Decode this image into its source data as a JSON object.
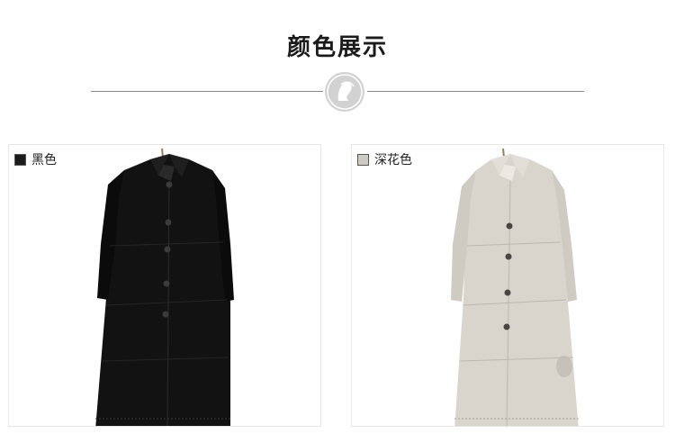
{
  "section": {
    "title": "颜色展示"
  },
  "colors": [
    {
      "label": "黑色",
      "swatch_color": "#1c1c1c",
      "icon": "black-swatch-icon"
    },
    {
      "label": "深花色",
      "swatch_color": "#cfcbc3",
      "icon": "oatmeal-swatch-icon"
    }
  ],
  "theme": {
    "divider_color": "#8a8a8a",
    "emblem_color": "#c9c9c9"
  }
}
